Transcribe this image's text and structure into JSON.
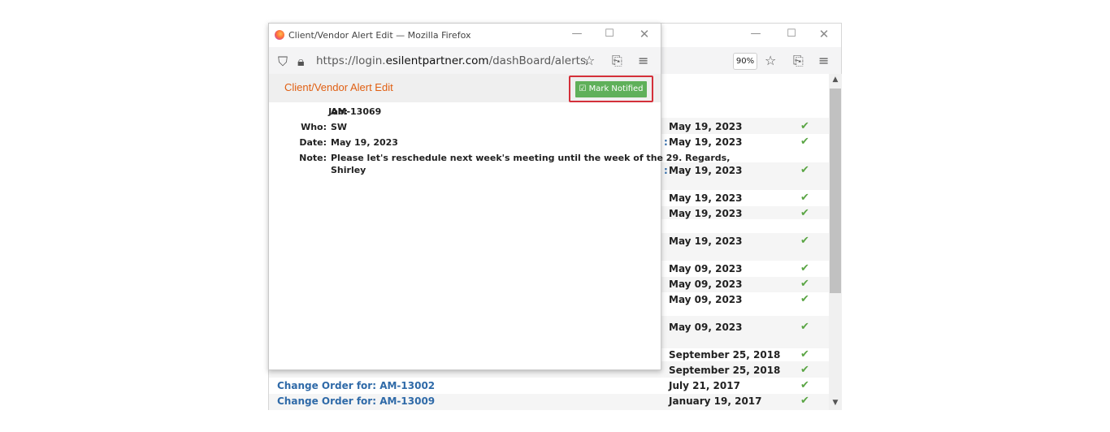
{
  "popup": {
    "window_title": "Client/Vendor Alert Edit — Mozilla Firefox",
    "url_prefix": "https://login.",
    "url_domain": "esilentpartner.com",
    "url_path": "/dashBoard/alerts/clientAlert",
    "heading": "Client/Vendor Alert Edit",
    "mark_button_label": "☑ Mark Notified",
    "fields": {
      "job_label": "Job:",
      "job_value": "AM-13069",
      "who_label": "Who:",
      "who_value": "SW",
      "date_label": "Date:",
      "date_value": "May 19, 2023",
      "note_label": "Note:",
      "note_line1": "Please let's reschedule next week's meeting until the week of the 29. Regards,",
      "note_line2": "Shirley"
    }
  },
  "background": {
    "zoom": "90%",
    "rows": [
      {
        "date": "May 19, 2023"
      },
      {
        "date": "May 19, 2023",
        "colon": ":"
      },
      {
        "date": "May 19, 2023",
        "colon": ":"
      },
      {
        "date": "May 19, 2023"
      },
      {
        "date": "May 19, 2023"
      },
      {
        "date": "May 19, 2023"
      },
      {
        "date": "May 09, 2023"
      },
      {
        "date": "May 09, 2023"
      },
      {
        "date": "May 09, 2023"
      },
      {
        "date": "May 09, 2023"
      },
      {
        "date": "September 25, 2018"
      },
      {
        "date": "September 25, 2018"
      },
      {
        "date": "July 21, 2017",
        "link": "Change Order for: AM-13002"
      },
      {
        "date": "January 19, 2017",
        "link": "Change Order for: AM-13009"
      }
    ],
    "check_glyph": "✔"
  },
  "icons": {
    "shield": "shield-icon",
    "lock": "lock-icon",
    "star": "star-icon",
    "extensions": "extensions-icon",
    "menu": "menu-icon"
  },
  "colors": {
    "accent": "#e05f12",
    "button": "#5fb05a",
    "highlight": "#d4303a",
    "link": "#2f6aa8",
    "check": "#5aa544"
  }
}
